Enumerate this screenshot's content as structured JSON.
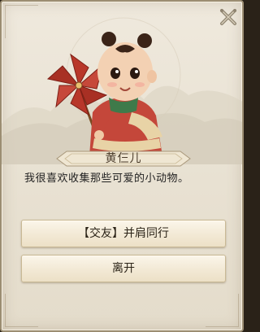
{
  "npc": {
    "name": "黄仨儿",
    "dialog": "我很喜欢收集那些可爱的小动物。"
  },
  "options": [
    {
      "label": "【交友】并肩同行"
    },
    {
      "label": "离开"
    }
  ],
  "icons": {
    "close": "close-x-icon",
    "portrait": "child-with-pinwheel-portrait"
  },
  "colors": {
    "panel_bg": "#ece5d6",
    "border": "#9b8d72",
    "button_bg": "#f5eddb",
    "pinwheel": "#b8372a",
    "robe": "#c4473a"
  }
}
